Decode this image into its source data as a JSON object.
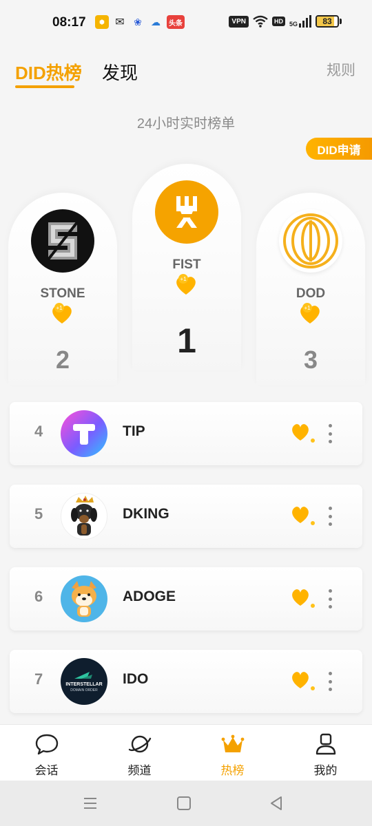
{
  "status": {
    "time": "08:17",
    "vpn": "VPN",
    "hd": "HD",
    "network": "5G",
    "battery": 83,
    "apps": [
      "toutiao-label"
    ],
    "toutiao_label": "头条"
  },
  "tabs": {
    "active": "DID热榜",
    "inactive": "发现"
  },
  "rules_label": "规则",
  "subtitle": "24小时实时榜单",
  "apply_button": "DID申请",
  "plus_label": "+1",
  "podium": {
    "first": {
      "name": "FIST",
      "rank": "1"
    },
    "second": {
      "name": "STONE",
      "rank": "2"
    },
    "third": {
      "name": "DOD",
      "rank": "3"
    }
  },
  "list": [
    {
      "rank": "4",
      "name": "TIP"
    },
    {
      "rank": "5",
      "name": "DKING"
    },
    {
      "rank": "6",
      "name": "ADOGE"
    },
    {
      "rank": "7",
      "name": "IDO"
    }
  ],
  "ido_logo_text": {
    "line1": "INTERSTELLAR",
    "line2": "DOMAIN ORDER"
  },
  "nav": [
    {
      "label": "会话",
      "icon": "chat-icon"
    },
    {
      "label": "频道",
      "icon": "planet-icon"
    },
    {
      "label": "热榜",
      "icon": "crown-icon"
    },
    {
      "label": "我的",
      "icon": "profile-icon"
    }
  ],
  "colors": {
    "accent": "#f4a100",
    "heart": "#ffb300"
  }
}
